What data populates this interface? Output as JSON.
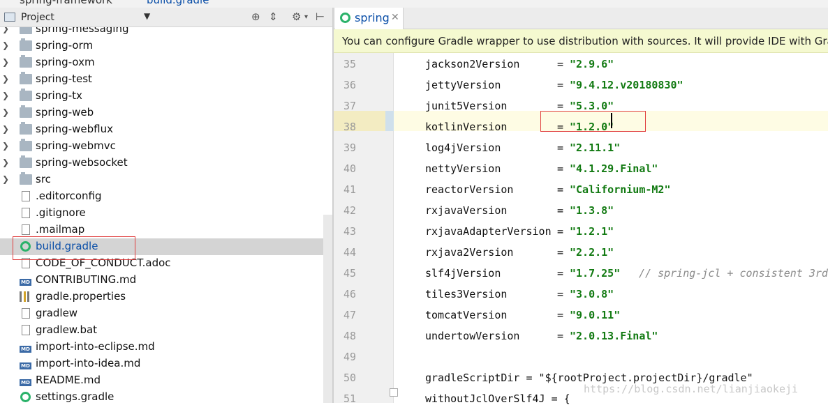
{
  "breadcrumb": {
    "project": "spring-framework",
    "file": "build.gradle"
  },
  "project_panel": {
    "title": "Project",
    "tree": [
      {
        "label": "spring-messaging",
        "type": "folder",
        "expandable": true
      },
      {
        "label": "spring-orm",
        "type": "folder",
        "expandable": true
      },
      {
        "label": "spring-oxm",
        "type": "folder",
        "expandable": true
      },
      {
        "label": "spring-test",
        "type": "folder",
        "expandable": true
      },
      {
        "label": "spring-tx",
        "type": "folder",
        "expandable": true
      },
      {
        "label": "spring-web",
        "type": "folder",
        "expandable": true
      },
      {
        "label": "spring-webflux",
        "type": "folder",
        "expandable": true
      },
      {
        "label": "spring-webmvc",
        "type": "folder",
        "expandable": true
      },
      {
        "label": "spring-websocket",
        "type": "folder",
        "expandable": true
      },
      {
        "label": "src",
        "type": "folder",
        "expandable": true
      },
      {
        "label": ".editorconfig",
        "type": "file"
      },
      {
        "label": ".gitignore",
        "type": "file"
      },
      {
        "label": ".mailmap",
        "type": "file"
      },
      {
        "label": "build.gradle",
        "type": "gradle",
        "selected": true
      },
      {
        "label": "CODE_OF_CONDUCT.adoc",
        "type": "file"
      },
      {
        "label": "CONTRIBUTING.md",
        "type": "md"
      },
      {
        "label": "gradle.properties",
        "type": "props"
      },
      {
        "label": "gradlew",
        "type": "file"
      },
      {
        "label": "gradlew.bat",
        "type": "file"
      },
      {
        "label": "import-into-eclipse.md",
        "type": "md"
      },
      {
        "label": "import-into-idea.md",
        "type": "md"
      },
      {
        "label": "README.md",
        "type": "md"
      },
      {
        "label": "settings.gradle",
        "type": "gradle"
      }
    ]
  },
  "editor": {
    "tab_label": "spring",
    "banner": "You can configure Gradle wrapper to use distribution with sources. It will provide IDE with Gradle",
    "lines": [
      {
        "num": "35",
        "name": "jackson2Version",
        "eq": "= ",
        "value": "\"2.9.6\"",
        "comment": ""
      },
      {
        "num": "36",
        "name": "jettyVersion",
        "eq": "= ",
        "value": "\"9.4.12.v20180830\"",
        "comment": ""
      },
      {
        "num": "37",
        "name": "junit5Version",
        "eq": "= ",
        "value": "\"5.3.0\"",
        "comment": ""
      },
      {
        "num": "38",
        "name": "kotlinVersion",
        "eq": "= ",
        "value": "\"1.2.0\"",
        "comment": ""
      },
      {
        "num": "39",
        "name": "log4jVersion",
        "eq": "= ",
        "value": "\"2.11.1\"",
        "comment": ""
      },
      {
        "num": "40",
        "name": "nettyVersion",
        "eq": "= ",
        "value": "\"4.1.29.Final\"",
        "comment": ""
      },
      {
        "num": "41",
        "name": "reactorVersion",
        "eq": "= ",
        "value": "\"Californium-M2\"",
        "comment": ""
      },
      {
        "num": "42",
        "name": "rxjavaVersion",
        "eq": "= ",
        "value": "\"1.3.8\"",
        "comment": ""
      },
      {
        "num": "43",
        "name": "rxjavaAdapterVersion",
        "eq": "= ",
        "value": "\"1.2.1\"",
        "comment": ""
      },
      {
        "num": "44",
        "name": "rxjava2Version",
        "eq": "= ",
        "value": "\"2.2.1\"",
        "comment": ""
      },
      {
        "num": "45",
        "name": "slf4jVersion",
        "eq": "= ",
        "value": "\"1.7.25\"",
        "comment": "// spring-jcl + consistent 3rd"
      },
      {
        "num": "46",
        "name": "tiles3Version",
        "eq": "= ",
        "value": "\"3.0.8\"",
        "comment": ""
      },
      {
        "num": "47",
        "name": "tomcatVersion",
        "eq": "= ",
        "value": "\"9.0.11\"",
        "comment": ""
      },
      {
        "num": "48",
        "name": "undertowVersion",
        "eq": "= ",
        "value": "\"2.0.13.Final\"",
        "comment": ""
      },
      {
        "num": "49",
        "name": "",
        "eq": "",
        "value": "",
        "comment": ""
      },
      {
        "num": "50",
        "name": "gradleScriptDir = \"${rootProject.projectDir}/gradle\"",
        "eq": "",
        "value": "",
        "comment": ""
      },
      {
        "num": "51",
        "name": "withoutJclOverSlf4J = {",
        "eq": "",
        "value": "",
        "comment": ""
      }
    ]
  },
  "watermark": "https://blog.csdn.net/lianjiaokeji"
}
